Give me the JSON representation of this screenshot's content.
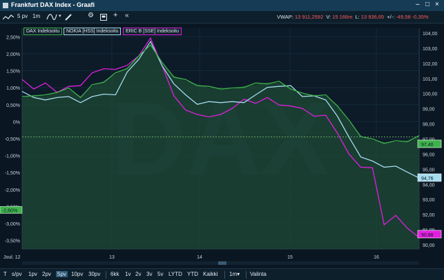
{
  "window": {
    "title": "Frankfurt DAX Index - Graafi"
  },
  "toolbar": {
    "interval": "5 pv",
    "resolution": "1m",
    "vwap_label": "VWAP:",
    "vwap_value": "13 911,2592",
    "volume_label": "V:",
    "volume_value": "15 166m",
    "last_label": "L:",
    "last_value": "13 936,65",
    "change_label": "+/-:",
    "change_value": "-49,58",
    "change_pct": "-0,35%"
  },
  "legend": [
    {
      "label": "DAX Indeksoitu",
      "color": "#3fb24c"
    },
    {
      "label": "NOKIA [HSS] Indeksoitu",
      "color": "#a6dcef"
    },
    {
      "label": "ERIC B [SSE] Indeksoitu",
      "color": "#e21ee0"
    }
  ],
  "chart_data": {
    "type": "line",
    "x_ticks": [
      "Joul. 12",
      "13",
      "14",
      "15",
      "16"
    ],
    "left_axis": {
      "ticks": [
        "2,50%",
        "2,00%",
        "1,50%",
        "1,00%",
        "0,50%",
        "0%",
        "-0,50%",
        "-1,00%",
        "-1,50%",
        "-2,00%",
        "-2,50%",
        "-3,00%",
        "-3,50%"
      ],
      "ylim": [
        -3.5,
        2.5
      ],
      "current_marker": "-2,60%"
    },
    "right_axis": {
      "ticks": [
        "104,00",
        "103,00",
        "102,00",
        "101,00",
        "100,00",
        "99,00",
        "98,00",
        "97,00",
        "96,00",
        "95,00",
        "94,00",
        "93,00",
        "92,00",
        "91,00",
        "90,00"
      ],
      "ylim": [
        90,
        104
      ]
    },
    "reference_line": {
      "y": -0.45
    },
    "series": [
      {
        "name": "DAX Indeksoitu",
        "color": "#3fb24c",
        "last_label": "97,40",
        "points": [
          [
            0,
            0.7
          ],
          [
            1,
            0.8
          ],
          [
            2,
            0.75
          ],
          [
            3,
            0.9
          ],
          [
            4,
            0.95
          ],
          [
            5,
            0.75
          ],
          [
            6,
            1.05
          ],
          [
            7,
            1.2
          ],
          [
            8,
            1.4
          ],
          [
            9,
            1.6
          ],
          [
            10,
            1.9
          ],
          [
            11,
            2.3
          ],
          [
            12,
            1.7
          ],
          [
            13,
            1.35
          ],
          [
            14,
            1.2
          ],
          [
            15,
            1.1
          ],
          [
            16,
            1.0
          ],
          [
            17,
            1.0
          ],
          [
            18,
            0.95
          ],
          [
            19,
            1.05
          ],
          [
            20,
            1.1
          ],
          [
            21,
            1.15
          ],
          [
            22,
            1.15
          ],
          [
            23,
            1.0
          ],
          [
            24,
            0.8
          ],
          [
            25,
            0.8
          ],
          [
            26,
            0.75
          ],
          [
            27,
            0.5
          ],
          [
            28,
            0.0
          ],
          [
            29,
            -0.4
          ],
          [
            30,
            -0.55
          ],
          [
            31,
            -0.6
          ],
          [
            32,
            -0.6
          ],
          [
            33,
            -0.55
          ],
          [
            34,
            -0.45
          ]
        ]
      },
      {
        "name": "NOKIA [HSS] Indeksoitu",
        "color": "#a6dcef",
        "last_label": "94,76",
        "points": [
          [
            0,
            0.85
          ],
          [
            1,
            0.75
          ],
          [
            2,
            0.6
          ],
          [
            3,
            0.75
          ],
          [
            4,
            0.7
          ],
          [
            5,
            0.6
          ],
          [
            6,
            0.7
          ],
          [
            7,
            0.85
          ],
          [
            8,
            0.75
          ],
          [
            9,
            1.5
          ],
          [
            10,
            1.8
          ],
          [
            11,
            2.4
          ],
          [
            12,
            1.6
          ],
          [
            13,
            1.15
          ],
          [
            14,
            0.75
          ],
          [
            15,
            0.55
          ],
          [
            16,
            0.55
          ],
          [
            17,
            0.6
          ],
          [
            18,
            0.55
          ],
          [
            19,
            0.6
          ],
          [
            20,
            0.75
          ],
          [
            21,
            1.05
          ],
          [
            22,
            1.0
          ],
          [
            23,
            1.1
          ],
          [
            24,
            0.7
          ],
          [
            25,
            0.8
          ],
          [
            26,
            0.6
          ],
          [
            27,
            0.2
          ],
          [
            28,
            -0.5
          ],
          [
            29,
            -1.0
          ],
          [
            30,
            -1.2
          ],
          [
            31,
            -1.3
          ],
          [
            32,
            -1.35
          ],
          [
            33,
            -1.45
          ],
          [
            34,
            -1.7
          ]
        ]
      },
      {
        "name": "ERIC B [SSE] Indeksoitu",
        "color": "#e21ee0",
        "last_label": "90,88",
        "points": [
          [
            0,
            1.2
          ],
          [
            1,
            1.0
          ],
          [
            2,
            1.1
          ],
          [
            3,
            0.9
          ],
          [
            4,
            1.0
          ],
          [
            5,
            1.1
          ],
          [
            6,
            1.4
          ],
          [
            7,
            1.6
          ],
          [
            8,
            1.5
          ],
          [
            9,
            1.7
          ],
          [
            10,
            1.9
          ],
          [
            11,
            2.5
          ],
          [
            12,
            1.6
          ],
          [
            13,
            0.8
          ],
          [
            14,
            0.3
          ],
          [
            15,
            0.25
          ],
          [
            16,
            0.1
          ],
          [
            17,
            0.25
          ],
          [
            18,
            0.35
          ],
          [
            19,
            0.7
          ],
          [
            20,
            0.5
          ],
          [
            21,
            0.75
          ],
          [
            22,
            0.45
          ],
          [
            23,
            0.5
          ],
          [
            24,
            0.35
          ],
          [
            25,
            0.2
          ],
          [
            26,
            0.15
          ],
          [
            27,
            -0.3
          ],
          [
            28,
            -1.0
          ],
          [
            29,
            -1.3
          ],
          [
            30,
            -1.4
          ],
          [
            31,
            -3.0
          ],
          [
            32,
            -2.8
          ],
          [
            33,
            -3.1
          ],
          [
            34,
            -3.45
          ]
        ]
      }
    ],
    "watermark": "DAX"
  },
  "bottom": {
    "t_label": "T",
    "periods": [
      "s/pv",
      "1pv",
      "2pv",
      "5pv",
      "10pv",
      "30pv",
      "6kk",
      "1v",
      "2v",
      "3v",
      "5v",
      "LYTD",
      "YTD",
      "Kaikki",
      "1m▾",
      "Valinta"
    ],
    "active_period": "5pv"
  },
  "colors": {
    "accent": "#163c55",
    "up": "#3fb24c",
    "down": "#ff5a5a"
  }
}
